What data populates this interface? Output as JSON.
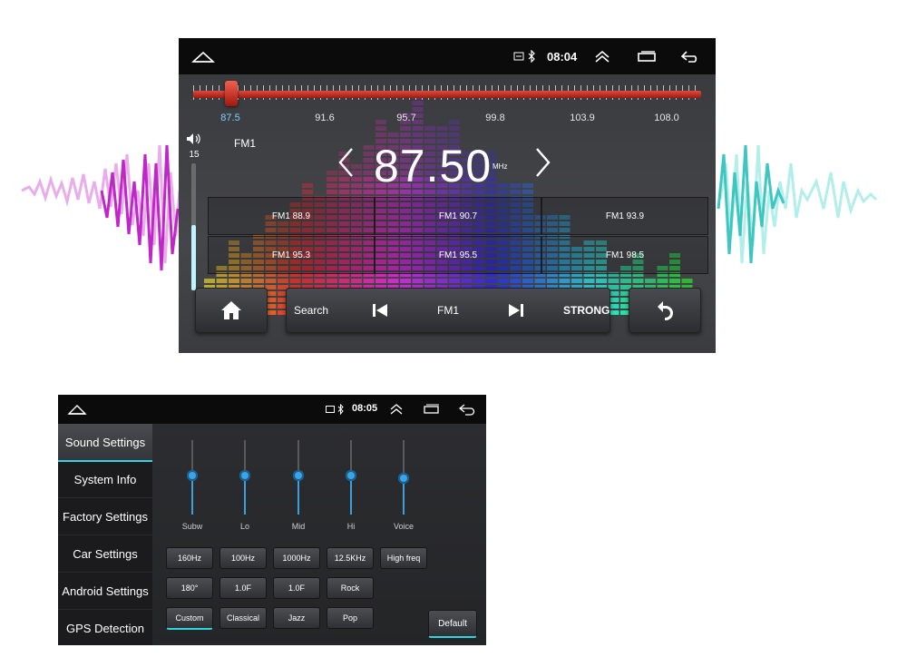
{
  "colors": {
    "accent": "#2fd6e0",
    "tuner_red": "#c72a1f",
    "selected_freq": "#7fd0ff"
  },
  "radio": {
    "status": {
      "time": "08:04",
      "icons": [
        "home-icon",
        "sim-icon",
        "bluetooth-icon",
        "chevron-up-icon",
        "recent-apps-icon",
        "back-icon"
      ]
    },
    "tuner": {
      "scale": [
        "87.5",
        "91.6",
        "95.7",
        "99.8",
        "103.9",
        "108.0"
      ],
      "selected": "87.5",
      "position": 0.07
    },
    "band": "FM1",
    "volume": {
      "value": "15",
      "level": 0.5
    },
    "frequency": "87.50",
    "unit": "MHz",
    "presets": [
      "FM1 88.9",
      "FM1 90.7",
      "FM1 93.9",
      "FM1 95.3",
      "FM1 95.5",
      "FM1 98.5"
    ],
    "controls": {
      "search": "Search",
      "band": "FM1",
      "signal": "STRONG"
    }
  },
  "sound": {
    "status": {
      "time": "08:05"
    },
    "menu": [
      "Sound Settings",
      "System Info",
      "Factory Settings",
      "Car Settings",
      "Android Settings",
      "GPS Detection"
    ],
    "active_menu": "Sound Settings",
    "sliders": [
      {
        "label": "Subw",
        "level": 0.82
      },
      {
        "label": "Lo",
        "level": 0.82
      },
      {
        "label": "Mid",
        "level": 0.82
      },
      {
        "label": "Hi",
        "level": 0.82
      },
      {
        "label": "Voice",
        "level": 0.75
      }
    ],
    "row1": [
      "160Hz",
      "100Hz",
      "1000Hz",
      "12.5KHz",
      "High freq"
    ],
    "row2": [
      "180°",
      "1.0F",
      "1.0F",
      "Rock"
    ],
    "row3": [
      "Custom",
      "Classical",
      "Jazz",
      "Pop"
    ],
    "active_preset": "Custom",
    "default_label": "Default"
  }
}
